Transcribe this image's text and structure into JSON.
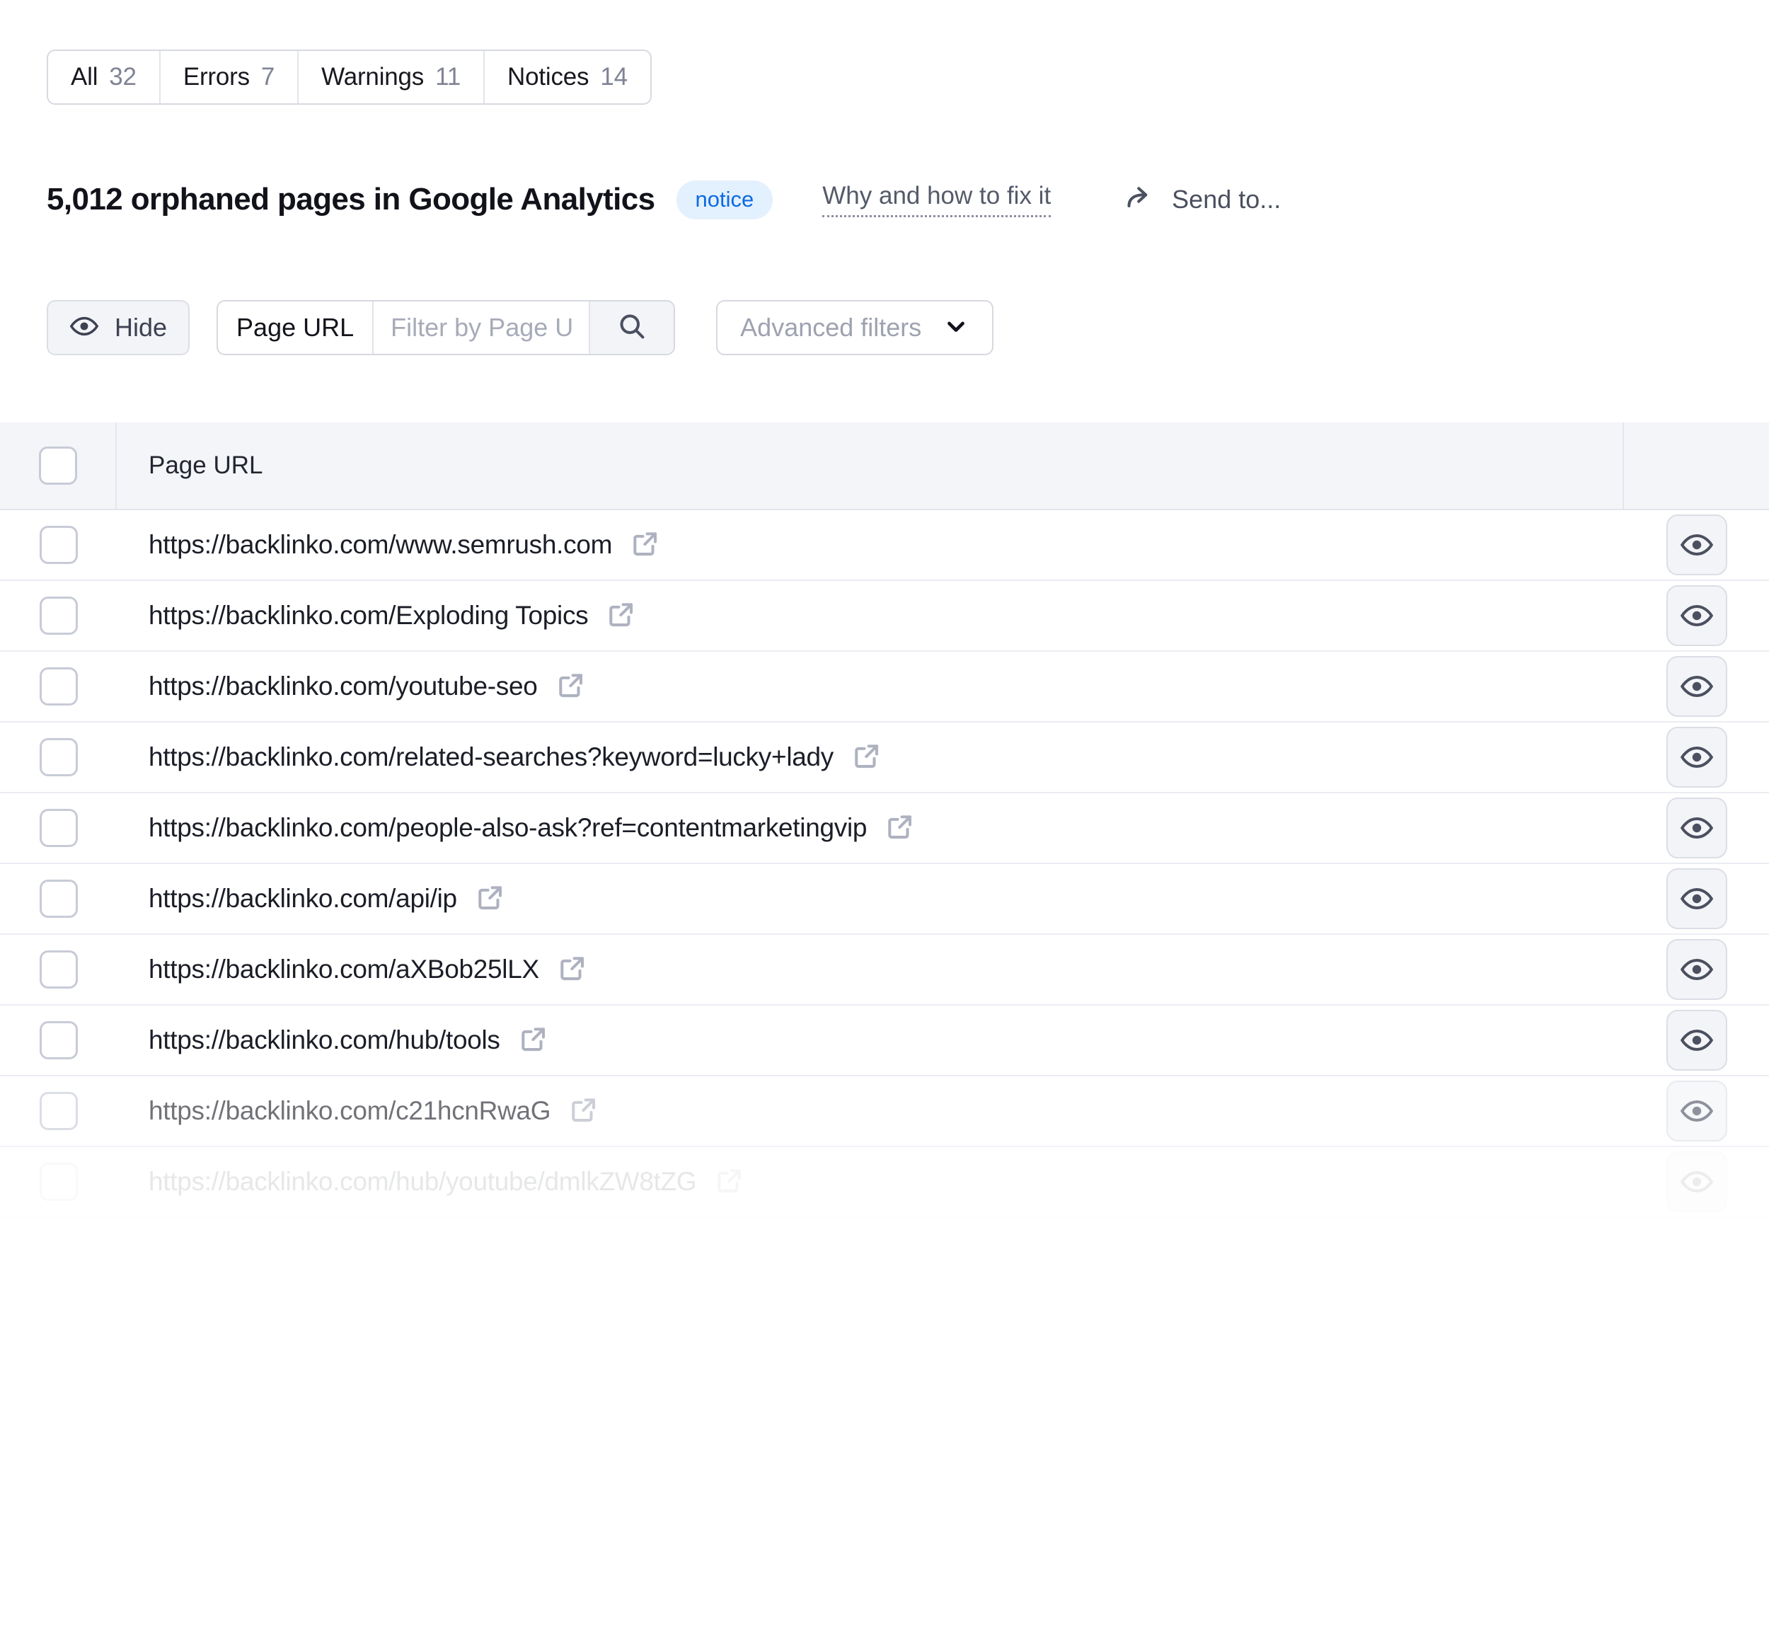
{
  "tabs": [
    {
      "label": "All",
      "count": "32"
    },
    {
      "label": "Errors",
      "count": "7"
    },
    {
      "label": "Warnings",
      "count": "11"
    },
    {
      "label": "Notices",
      "count": "14"
    }
  ],
  "header": {
    "title": "5,012 orphaned pages in Google Analytics",
    "badge": "notice",
    "fix_link": "Why and how to fix it",
    "send_to": "Send to...",
    "share_icon": "share-arrow-icon"
  },
  "toolbar": {
    "hide_label": "Hide",
    "hide_icon": "eye-icon",
    "search_field_label": "Page URL",
    "search_placeholder": "Filter by Page URL",
    "search_value": "",
    "search_icon": "search-icon",
    "advanced_filters_label": "Advanced filters",
    "advanced_filters_icon": "chevron-down-icon"
  },
  "table": {
    "columns": [
      "Page URL"
    ],
    "row_action_icon": "eye-icon",
    "row_link_icon": "external-link-icon",
    "rows": [
      {
        "url": "https://backlinko.com/www.semrush.com"
      },
      {
        "url": "https://backlinko.com/Exploding Topics"
      },
      {
        "url": "https://backlinko.com/youtube-seo"
      },
      {
        "url": "https://backlinko.com/related-searches?keyword=lucky+lady"
      },
      {
        "url": "https://backlinko.com/people-also-ask?ref=contentmarketingvip"
      },
      {
        "url": "https://backlinko.com/api/ip"
      },
      {
        "url": "https://backlinko.com/aXBob25lLX"
      },
      {
        "url": "https://backlinko.com/hub/tools"
      },
      {
        "url": "https://backlinko.com/c21hcnRwaG"
      },
      {
        "url": "https://backlinko.com/hub/youtube/dmlkZW8tZG"
      }
    ]
  },
  "colors": {
    "accent": "#0d6ae4",
    "badge_bg": "#e3f0fd",
    "header_bg": "#f4f5f9",
    "text": "#1b1d27",
    "muted": "#7f8394",
    "border": "#d6d9e0"
  }
}
